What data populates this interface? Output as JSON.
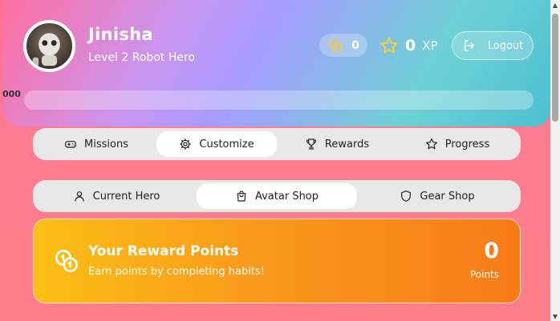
{
  "user": {
    "name": "Jinisha",
    "level": "Level 2 Robot Hero",
    "avatar_icon": "robot-avatar"
  },
  "stats": {
    "coins": "0",
    "xp_value": "0",
    "xp_label": "XP"
  },
  "logout_label": "Logout",
  "progress": {
    "label": "000",
    "fraction": 0
  },
  "main_tabs": [
    {
      "label": "Missions",
      "icon": "gamepad-icon"
    },
    {
      "label": "Customize",
      "icon": "gear-icon",
      "active": true
    },
    {
      "label": "Rewards",
      "icon": "trophy-icon"
    },
    {
      "label": "Progress",
      "icon": "star-icon"
    }
  ],
  "sub_tabs": [
    {
      "label": "Current Hero",
      "icon": "person-icon"
    },
    {
      "label": "Avatar Shop",
      "icon": "shopping-bag-icon",
      "active": true
    },
    {
      "label": "Gear Shop",
      "icon": "shield-icon"
    }
  ],
  "reward_card": {
    "title": "Your Reward Points",
    "subtitle": "Earn points by completing habits!",
    "value": "0",
    "unit": "Points"
  },
  "colors": {
    "card_start": "#fbbf15",
    "card_end": "#f77b18",
    "page_bg": "#ff7b8f"
  }
}
